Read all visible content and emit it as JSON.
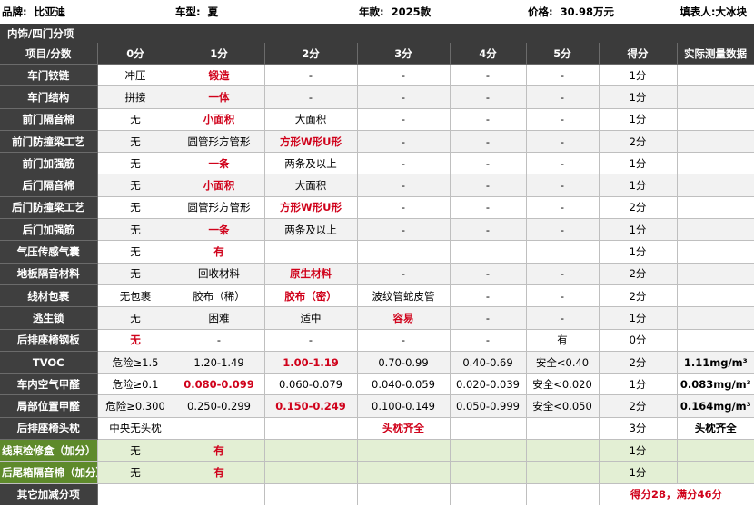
{
  "header": {
    "brand_label": "品牌:",
    "brand": "比亚迪",
    "model_label": "车型:",
    "model": "夏",
    "year_label": "年款:",
    "year": "2025款",
    "price_label": "价格:",
    "price": "30.98万元",
    "author_label": "填表人:",
    "author": "大冰块"
  },
  "section_title": "内饰/四门分项",
  "columns": [
    "项目/分数",
    "0分",
    "1分",
    "2分",
    "3分",
    "4分",
    "5分",
    "得分",
    "实际测量数据"
  ],
  "rows": [
    {
      "item": "车门铰链",
      "c": [
        "冲压",
        "锻造",
        "-",
        "-",
        "-",
        "-"
      ],
      "sel": 1,
      "score": "1分",
      "measure": ""
    },
    {
      "item": "车门结构",
      "c": [
        "拼接",
        "一体",
        "-",
        "-",
        "-",
        "-"
      ],
      "sel": 1,
      "score": "1分",
      "measure": ""
    },
    {
      "item": "前门隔音棉",
      "c": [
        "无",
        "小面积",
        "大面积",
        "-",
        "-",
        "-"
      ],
      "sel": 1,
      "score": "1分",
      "measure": ""
    },
    {
      "item": "前门防撞梁工艺",
      "c": [
        "无",
        "圆管形方管形",
        "方形W形U形",
        "-",
        "-",
        "-"
      ],
      "sel": 2,
      "score": "2分",
      "measure": ""
    },
    {
      "item": "前门加强筋",
      "c": [
        "无",
        "一条",
        "两条及以上",
        "-",
        "-",
        "-"
      ],
      "sel": 1,
      "score": "1分",
      "measure": ""
    },
    {
      "item": "后门隔音棉",
      "c": [
        "无",
        "小面积",
        "大面积",
        "-",
        "-",
        "-"
      ],
      "sel": 1,
      "score": "1分",
      "measure": ""
    },
    {
      "item": "后门防撞梁工艺",
      "c": [
        "无",
        "圆管形方管形",
        "方形W形U形",
        "-",
        "-",
        "-"
      ],
      "sel": 2,
      "score": "2分",
      "measure": ""
    },
    {
      "item": "后门加强筋",
      "c": [
        "无",
        "一条",
        "两条及以上",
        "-",
        "-",
        "-"
      ],
      "sel": 1,
      "score": "1分",
      "measure": ""
    },
    {
      "item": "气压传感气囊",
      "c": [
        "无",
        "有",
        "",
        "",
        "",
        ""
      ],
      "sel": 1,
      "score": "1分",
      "measure": ""
    },
    {
      "item": "地板隔音材料",
      "c": [
        "无",
        "回收材料",
        "原生材料",
        "-",
        "-",
        "-"
      ],
      "sel": 2,
      "score": "2分",
      "measure": ""
    },
    {
      "item": "线材包裹",
      "c": [
        "无包裹",
        "胶布（稀）",
        "胶布（密）",
        "波纹管蛇皮管",
        "-",
        "-"
      ],
      "sel": 2,
      "score": "2分",
      "measure": ""
    },
    {
      "item": "逃生锁",
      "c": [
        "无",
        "困难",
        "适中",
        "容易",
        "-",
        "-"
      ],
      "sel": 3,
      "score": "1分",
      "measure": ""
    },
    {
      "item": "后排座椅钢板",
      "c": [
        "无",
        "-",
        "-",
        "-",
        "-",
        "有"
      ],
      "sel": 0,
      "score": "0分",
      "measure": ""
    },
    {
      "item": "TVOC",
      "c": [
        "危险≥1.5",
        "1.20-1.49",
        "1.00-1.19",
        "0.70-0.99",
        "0.40-0.69",
        "安全<0.40"
      ],
      "sel": 2,
      "score": "2分",
      "measure": "1.11mg/m³"
    },
    {
      "item": "车内空气甲醛",
      "c": [
        "危险≥0.1",
        "0.080-0.099",
        "0.060-0.079",
        "0.040-0.059",
        "0.020-0.039",
        "安全<0.020"
      ],
      "sel": 1,
      "score": "1分",
      "measure": "0.083mg/m³"
    },
    {
      "item": "局部位置甲醛",
      "c": [
        "危险≥0.300",
        "0.250-0.299",
        "0.150-0.249",
        "0.100-0.149",
        "0.050-0.999",
        "安全<0.050"
      ],
      "sel": 2,
      "score": "2分",
      "measure": "0.164mg/m³"
    },
    {
      "item": "后排座椅头枕",
      "c": [
        "中央无头枕",
        "",
        "",
        "头枕齐全",
        "",
        ""
      ],
      "sel": 3,
      "score": "3分",
      "measure": "头枕齐全"
    },
    {
      "item": "线束检修盒（加分）",
      "c": [
        "无",
        "有",
        "",
        "",
        "",
        ""
      ],
      "sel": 1,
      "score": "1分",
      "measure": "",
      "bonus": true
    },
    {
      "item": "后尾箱隔音棉（加分）",
      "c": [
        "无",
        "有",
        "",
        "",
        "",
        ""
      ],
      "sel": 1,
      "score": "1分",
      "measure": "",
      "bonus": true
    }
  ],
  "footer": {
    "label": "其它加减分项",
    "total": "得分28，满分46分"
  }
}
